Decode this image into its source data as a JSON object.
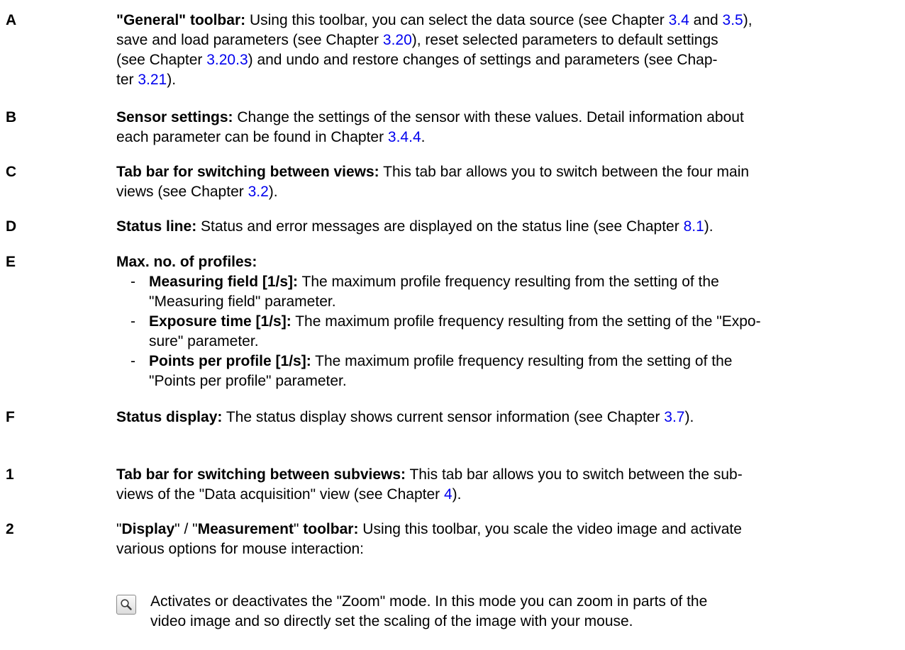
{
  "entries": {
    "A": {
      "key": "A",
      "line1": {
        "title": "\"General\" toolbar:",
        "t1": " Using this toolbar, you can select the data source (see Chapter ",
        "r1": "3.4",
        "t2": " and ",
        "r2": "3.5",
        "t3": "),"
      },
      "line2": {
        "t1": "save and load parameters (see Chapter ",
        "r1": "3.20",
        "t2": "), reset selected parameters to default settings"
      },
      "line3": {
        "t1": "(see Chapter ",
        "r1": "3.20.3",
        "t2": ") and undo and restore changes of settings and parameters (see Chap-"
      },
      "line4": {
        "t1": "ter ",
        "r1": "3.21",
        "t2": ")."
      }
    },
    "B": {
      "key": "B",
      "line1": {
        "title": "Sensor settings:",
        "t1": " Change the settings of the sensor with these values. Detail information about"
      },
      "line2": {
        "t1": "each parameter can be found in Chapter ",
        "r1": "3.4.4",
        "t2": "."
      }
    },
    "C": {
      "key": "C",
      "line1": {
        "title": "Tab bar for switching between views:",
        "t1": " This tab bar allows you to switch between the four main"
      },
      "line2": {
        "t1": "views (see Chapter ",
        "r1": "3.2",
        "t2": ")."
      }
    },
    "D": {
      "key": "D",
      "line1": {
        "title": "Status line:",
        "t1": " Status and error messages are displayed on the status line (see Chapter ",
        "r1": "8.1",
        "t2": ")."
      }
    },
    "E": {
      "key": "E",
      "title": "Max. no. of profiles:",
      "items": [
        {
          "dash": "-",
          "title": "Measuring field [1/s]:",
          "t1": " The maximum profile frequency resulting from the setting of the",
          "t2": "\"Measuring field\" parameter."
        },
        {
          "dash": "-",
          "title": "Exposure time [1/s]:",
          "t1": " The maximum profile frequency resulting from the setting of the \"Expo-",
          "t2": "sure\" parameter."
        },
        {
          "dash": "-",
          "title": "Points per profile [1/s]:",
          "t1": " The maximum profile frequency resulting from the setting of the",
          "t2": "\"Points per profile\" parameter."
        }
      ]
    },
    "F": {
      "key": "F",
      "line1": {
        "title": "Status display:",
        "t1": " The status display shows current sensor information (see Chapter ",
        "r1": "3.7",
        "t2": ")."
      }
    },
    "n1": {
      "key": "1",
      "line1": {
        "title": "Tab bar for switching between subviews:",
        "t1": " This tab bar allows you to switch between the sub-"
      },
      "line2": {
        "t1": "views of the \"Data acquisition\" view (see Chapter ",
        "r1": "4",
        "t2": ")."
      }
    },
    "n2": {
      "key": "2",
      "line1": {
        "q1": "\"",
        "b1": "Display",
        "q2": "\" / \"",
        "b2": "Measurement",
        "q3": "\" ",
        "b3": "toolbar:",
        "t1": " Using this toolbar, you scale the video image and activate"
      },
      "line2": {
        "t1": "various options for mouse interaction:"
      }
    },
    "zoom": {
      "icon": "zoom-magnifier-icon",
      "line1": "Activates or deactivates the \"Zoom\" mode. In this mode you can zoom in parts of the",
      "line2": "video image and so directly set the scaling of the image with your mouse."
    }
  }
}
